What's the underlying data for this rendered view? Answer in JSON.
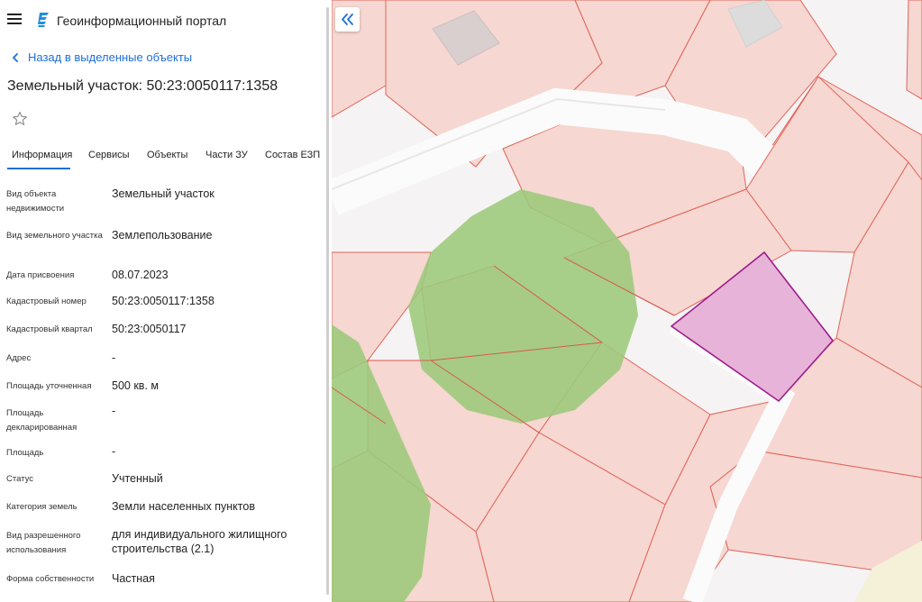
{
  "header": {
    "app_title": "Геоинформационный портал"
  },
  "back_link": "Назад в выделенные объекты",
  "page_title": "Земельный участок: 50:23:0050117:1358",
  "tabs": [
    {
      "label": "Информация",
      "active": true
    },
    {
      "label": "Сервисы"
    },
    {
      "label": "Объекты"
    },
    {
      "label": "Части ЗУ"
    },
    {
      "label": "Состав ЕЗП"
    }
  ],
  "attributes": [
    {
      "label": "Вид объекта недвижимости",
      "value": "Земельный участок"
    },
    {
      "label": "Вид земельного участка",
      "value": "Землепользование"
    },
    {
      "label": "Дата присвоения",
      "value": "08.07.2023"
    },
    {
      "label": "Кадастровый номер",
      "value": "50:23:0050117:1358"
    },
    {
      "label": "Кадастровый квартал",
      "value": "50:23:0050117"
    },
    {
      "label": "Адрес",
      "value": "-"
    },
    {
      "label": "Площадь уточненная",
      "value": "500 кв. м"
    },
    {
      "label": "Площадь декларированная",
      "value": "-"
    },
    {
      "label": "Площадь",
      "value": "-"
    },
    {
      "label": "Статус",
      "value": "Учтенный"
    },
    {
      "label": "Категория земель",
      "value": "Земли населенных пунктов"
    },
    {
      "label": "Вид разрешенного использования",
      "value": "для индивидуального жилищного строительства (2.1)"
    },
    {
      "label": "Форма собственности",
      "value": "Частная"
    }
  ],
  "colors": {
    "accent": "#1e6fd9",
    "parcel_fill": "#f6d7d1",
    "parcel_stroke": "#e0645a",
    "selected_fill": "#e7b3d8",
    "selected_stroke": "#9b1c8c",
    "vegetation": "#9cc97a",
    "road": "#f7f7f7"
  },
  "icons": {
    "menu": "hamburger-icon",
    "logo": "portal-logo-icon",
    "back": "chevron-left-icon",
    "favorite": "star-outline-icon",
    "collapse": "double-chevron-left-icon"
  }
}
